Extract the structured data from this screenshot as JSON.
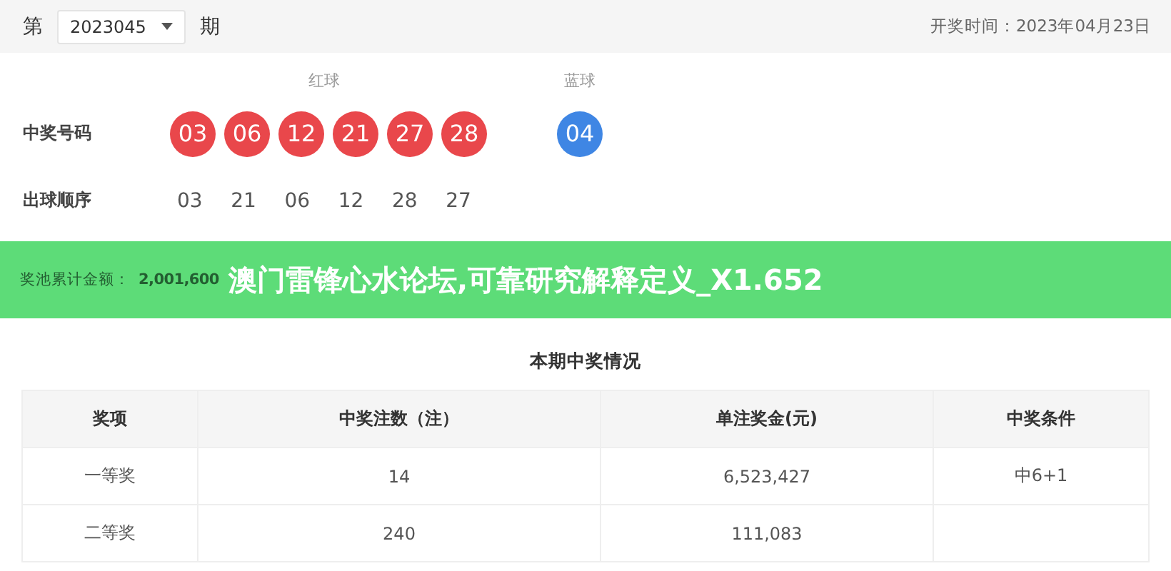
{
  "period": {
    "prefix": "第",
    "value": "2023045",
    "suffix": "期",
    "draw_date": "开奖时间：2023年04月23日"
  },
  "balls": {
    "red_label": "红球",
    "blue_label": "蓝球",
    "row_label": "中奖号码",
    "numbers": [
      {
        "text": "03",
        "kind": "red"
      },
      {
        "text": "06",
        "kind": "red"
      },
      {
        "text": "12",
        "kind": "red"
      },
      {
        "text": "21",
        "kind": "red"
      },
      {
        "text": "27",
        "kind": "red"
      },
      {
        "text": "28",
        "kind": "red"
      },
      {
        "text": "04",
        "kind": "blue"
      }
    ]
  },
  "order": {
    "label": "出球顺序",
    "numbers": [
      "03",
      "21",
      "06",
      "12",
      "28",
      "27"
    ]
  },
  "prize_pool": {
    "label": "奖池累计金额：",
    "value": "2,001,600"
  },
  "banner": "澳门雷锋心水论坛,可靠研究解释定义_X1.652",
  "table": {
    "title": "本期中奖情况",
    "columns": [
      "奖项",
      "中奖注数（注）",
      "单注奖金(元)",
      "中奖条件"
    ],
    "rows": [
      [
        "一等奖",
        "14",
        "6,523,427",
        "中6+1"
      ],
      [
        "二等奖",
        "240",
        "111,083"
      ]
    ]
  }
}
